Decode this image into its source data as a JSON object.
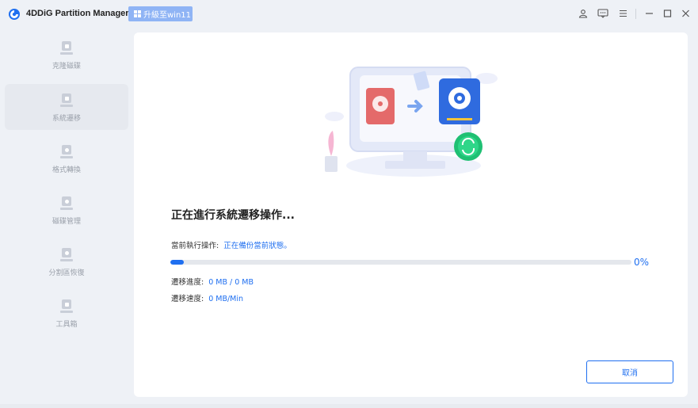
{
  "app": {
    "title": "4DDiG Partition Manager",
    "upgrade_label": "升級至win11"
  },
  "window_controls": {
    "account_icon": "user-icon",
    "feedback_icon": "chat-icon",
    "menu_icon": "hamburger-icon",
    "minimize": "minimize-icon",
    "maximize": "maximize-icon",
    "close": "close-icon"
  },
  "sidebar": {
    "items": [
      {
        "label": "克隆磁碟",
        "icon": "clone-icon",
        "active": false
      },
      {
        "label": "系統遷移",
        "icon": "migrate-icon",
        "active": true
      },
      {
        "label": "格式轉換",
        "icon": "convert-icon",
        "active": false
      },
      {
        "label": "磁碟管理",
        "icon": "disk-manage-icon",
        "active": false
      },
      {
        "label": "分割區恢復",
        "icon": "partition-recover-icon",
        "active": false
      },
      {
        "label": "工具箱",
        "icon": "toolbox-icon",
        "active": false
      }
    ]
  },
  "main": {
    "heading": "正在進行系統遷移操作...",
    "current_op_label": "當前執行操作:",
    "current_op_value": "正在備份當前狀態。",
    "progress_value": 0.03,
    "progress_percent": "0%",
    "migrate_progress_label": "遷移進度:",
    "migrate_progress_value": "0 MB /  0 MB",
    "migrate_speed_label": "遷移速度:",
    "migrate_speed_value": "0 MB/Min",
    "cancel_label": "取消"
  },
  "colors": {
    "accent": "#1f6ff0",
    "upgrade_bg": "#8fb4f5",
    "progress_track": "#e4e7ec"
  }
}
